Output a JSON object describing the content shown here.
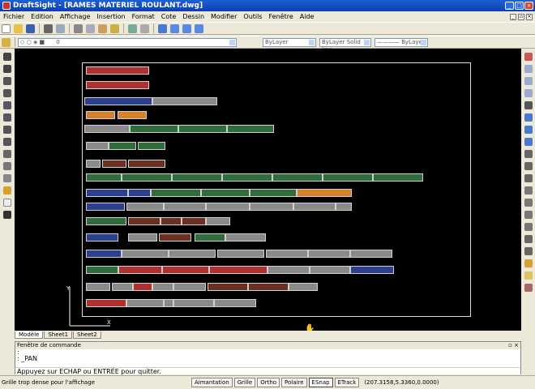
{
  "window": {
    "title": "DraftSight - [RAMES MATERIEL ROULANT.dwg]"
  },
  "menu": [
    "Fichier",
    "Edition",
    "Affichage",
    "Insertion",
    "Format",
    "Cote",
    "Dessin",
    "Modifier",
    "Outils",
    "Fenêtre",
    "Aide"
  ],
  "toolbar": {
    "layer_value": "0",
    "color_combo": "ByLayer",
    "linetype_combo": "ByLayer",
    "linestyle_combo": "Solid line",
    "lineweight_combo": "———— ByLayer"
  },
  "tabs": [
    "Modèle",
    "Sheet1",
    "Sheet2"
  ],
  "command_window": {
    "title": "Fenêtre de commande",
    "history": [
      ":",
      ": _PAN"
    ],
    "prompt": "Appuyez sur ECHAP ou ENTRÉE pour quitter."
  },
  "status": {
    "message": "Grille trop dense pour l'affichage",
    "buttons": [
      {
        "label": "Aimantation",
        "on": false
      },
      {
        "label": "Grille",
        "on": false
      },
      {
        "label": "Ortho",
        "on": false
      },
      {
        "label": "Polaire",
        "on": false
      },
      {
        "label": "ESnap",
        "on": true
      },
      {
        "label": "ETrack",
        "on": false
      }
    ],
    "coordinates": "(207.3158,5.3360,0.0000)"
  },
  "colors": {
    "canvas": "#000000",
    "titlebar": "#0b3fb0",
    "wagon_green": "#2f6e3a",
    "wagon_red": "#b03030",
    "wagon_blue": "#2a3f8e",
    "wagon_orange": "#d7822a",
    "wagon_grey": "#8a8a8a",
    "wagon_brown": "#6b3020"
  }
}
